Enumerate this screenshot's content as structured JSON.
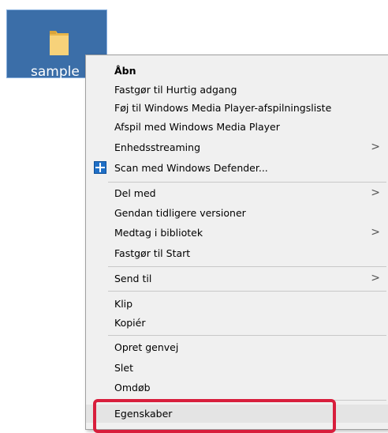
{
  "desktop": {
    "file_label": "sample"
  },
  "context_menu": {
    "items": [
      {
        "label": "Åbn"
      },
      {
        "label": "Fastgør til Hurtig adgang"
      },
      {
        "label": "Føj til Windows Media Player-afspilningsliste"
      },
      {
        "label": "Afspil med Windows Media Player"
      },
      {
        "label": "Enhedsstreaming",
        "submenu": true
      },
      {
        "label": "Scan med Windows Defender...",
        "icon": "windows-defender-shield-icon"
      },
      {
        "label": "Del med",
        "submenu": true
      },
      {
        "label": "Gendan tidligere versioner"
      },
      {
        "label": "Medtag i bibliotek",
        "submenu": true
      },
      {
        "label": "Fastgør til Start"
      },
      {
        "label": "Send til",
        "submenu": true
      },
      {
        "label": "Klip"
      },
      {
        "label": "Kopiér"
      },
      {
        "label": "Opret genvej"
      },
      {
        "label": "Slet"
      },
      {
        "label": "Omdøb"
      },
      {
        "label": "Egenskaber",
        "highlighted": true
      }
    ],
    "submenu_arrow": ">"
  },
  "highlight_color": "#d81e3c"
}
